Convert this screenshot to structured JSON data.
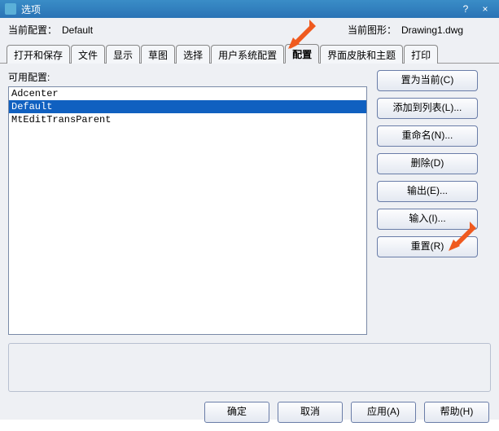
{
  "window": {
    "title": "选项"
  },
  "header": {
    "current_config_label": "当前配置：",
    "current_config_value": "Default",
    "current_drawing_label": "当前图形：",
    "current_drawing_value": "Drawing1.dwg"
  },
  "tabs": [
    {
      "label": "打开和保存"
    },
    {
      "label": "文件"
    },
    {
      "label": "显示"
    },
    {
      "label": "草图"
    },
    {
      "label": "选择"
    },
    {
      "label": "用户系统配置"
    },
    {
      "label": "配置"
    },
    {
      "label": "界面皮肤和主题"
    },
    {
      "label": "打印"
    }
  ],
  "active_tab_index": 6,
  "profiles": {
    "label": "可用配置:",
    "items": [
      "Adcenter",
      "Default",
      "MtEditTransParent"
    ],
    "selected_index": 1
  },
  "side_buttons": {
    "set_current": "置为当前(C)",
    "add_to_list": "添加到列表(L)...",
    "rename": "重命名(N)...",
    "delete": "删除(D)",
    "export": "输出(E)...",
    "import": "输入(I)...",
    "reset": "重置(R)"
  },
  "footer": {
    "ok": "确定",
    "cancel": "取消",
    "apply": "应用(A)",
    "help": "帮助(H)"
  }
}
